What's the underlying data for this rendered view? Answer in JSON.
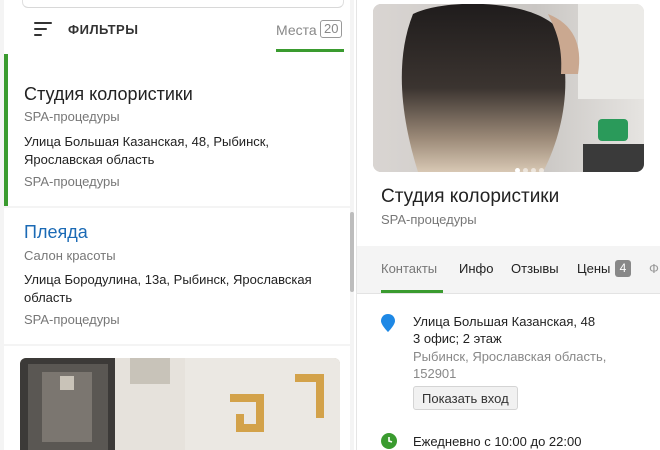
{
  "filters": {
    "label": "ФИЛЬТРЫ"
  },
  "places_tab": {
    "label": "Места",
    "count": "20"
  },
  "results": [
    {
      "title": "Студия колористики",
      "subtitle": "SPA-процедуры",
      "address": "Улица Большая Казанская, 48, Рыбинск, Ярославская область",
      "category": "SPA-процедуры"
    },
    {
      "title": "Плеяда",
      "subtitle": "Салон красоты",
      "address": "Улица Бородулина, 13а, Рыбинск, Ярославская область",
      "category": "SPA-процедуры"
    }
  ],
  "details": {
    "title": "Студия колористики",
    "subtitle": "SPA-процедуры",
    "tabs": {
      "contacts": "Контакты",
      "info": "Инфо",
      "reviews": "Отзывы",
      "prices": "Цены",
      "prices_count": "4",
      "more": "Ф"
    },
    "address_line1": "Улица Большая Казанская, 48",
    "address_line2": "3 офис; 2 этаж",
    "address_line3": "Рыбинск, Ярославская область, 152901",
    "show_entrance": "Показать вход",
    "hours": "Ежедневно с 10:00 до 22:00"
  },
  "colors": {
    "accent": "#3a9b2f",
    "link": "#1b6ab5",
    "pin": "#1e88e5"
  }
}
